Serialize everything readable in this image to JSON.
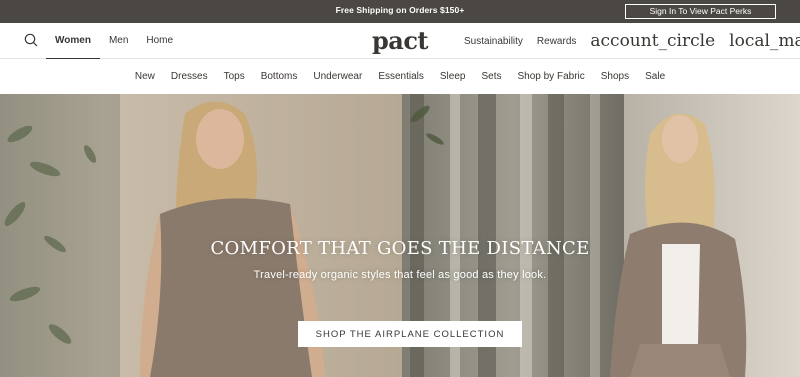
{
  "promo": {
    "text": "Free Shipping on Orders $150+",
    "perks_button": "Sign In To View Pact Perks"
  },
  "header": {
    "logo": "pact",
    "nav_left": [
      "Women",
      "Men",
      "Home"
    ],
    "nav_right": [
      "Sustainability",
      "Rewards"
    ],
    "account_icon_text": "account_circle",
    "bag_icon_text": "local_mall"
  },
  "categories": [
    "New",
    "Dresses",
    "Tops",
    "Bottoms",
    "Underwear",
    "Essentials",
    "Sleep",
    "Sets",
    "Shop by Fabric",
    "Shops",
    "Sale"
  ],
  "hero": {
    "title": "COMFORT THAT GOES THE DISTANCE",
    "subtitle": "Travel-ready organic styles that feel as good as they look.",
    "cta": "SHOP THE AIRPLANE COLLECTION"
  },
  "colors": {
    "promo_bg": "#4b4843",
    "text": "#3a3733",
    "hero_left": "#b5aa9b",
    "hero_mid": "#8c8a80",
    "hero_right": "#cfc8bd"
  }
}
